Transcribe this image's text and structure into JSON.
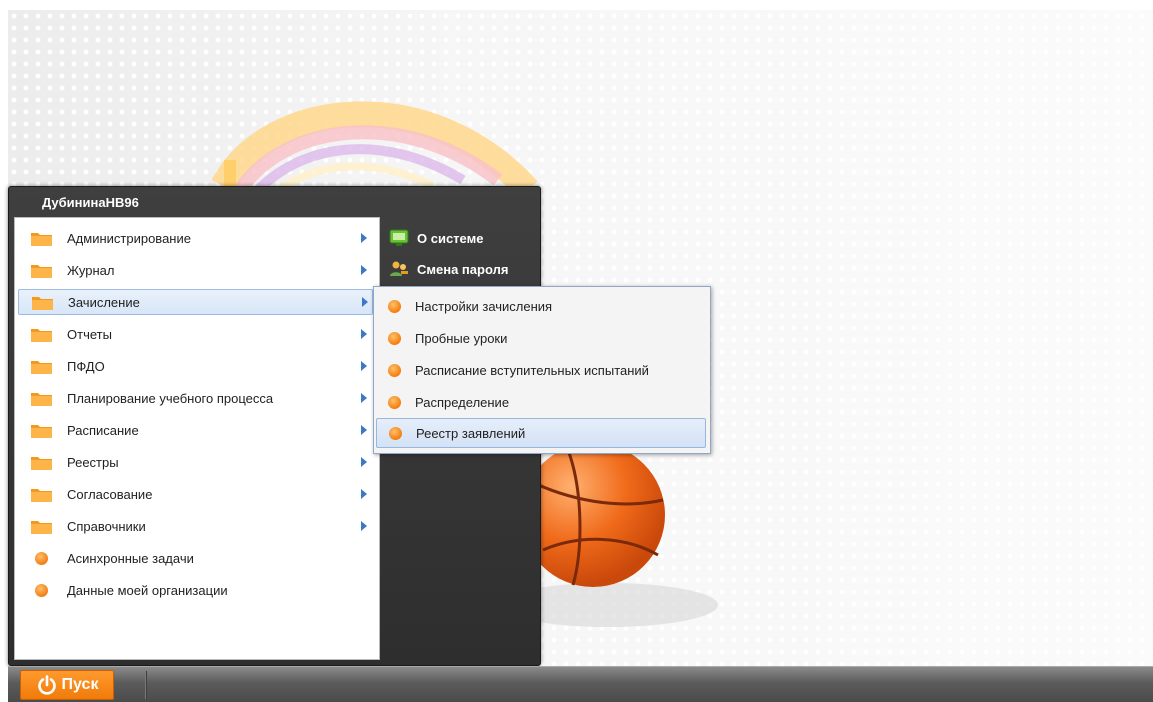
{
  "start_menu": {
    "user_name": "ДубининаНВ96",
    "left_items": [
      {
        "label": "Администрирование",
        "icon": "folder-icon",
        "has_submenu": true
      },
      {
        "label": "Журнал",
        "icon": "folder-icon",
        "has_submenu": true
      },
      {
        "label": "Зачисление",
        "icon": "folder-icon",
        "has_submenu": true,
        "active": true
      },
      {
        "label": "Отчеты",
        "icon": "folder-icon",
        "has_submenu": true
      },
      {
        "label": "ПФДО",
        "icon": "folder-icon",
        "has_submenu": true
      },
      {
        "label": "Планирование учебного процесса",
        "icon": "folder-icon",
        "has_submenu": true
      },
      {
        "label": "Расписание",
        "icon": "folder-icon",
        "has_submenu": true
      },
      {
        "label": "Реестры",
        "icon": "folder-icon",
        "has_submenu": true
      },
      {
        "label": "Согласование",
        "icon": "folder-icon",
        "has_submenu": true
      },
      {
        "label": "Справочники",
        "icon": "folder-icon",
        "has_submenu": true
      },
      {
        "label": "Асинхронные задачи",
        "icon": "dot-icon",
        "has_submenu": false
      },
      {
        "label": "Данные моей организации",
        "icon": "dot-icon",
        "has_submenu": false
      }
    ],
    "right_items": [
      {
        "label": "О системе",
        "icon": "monitor-icon"
      },
      {
        "label": "Смена пароля",
        "icon": "users-key-icon"
      }
    ]
  },
  "submenu": {
    "items": [
      {
        "label": "Настройки зачисления"
      },
      {
        "label": "Пробные уроки"
      },
      {
        "label": "Расписание вступительных испытаний"
      },
      {
        "label": "Распределение"
      },
      {
        "label": "Реестр заявлений",
        "active": true
      }
    ]
  },
  "taskbar": {
    "start_label": "Пуск"
  },
  "colors": {
    "accent_orange": "#f57d10",
    "menu_dark": "#333333",
    "highlight_blue": "#d8e6f7"
  }
}
